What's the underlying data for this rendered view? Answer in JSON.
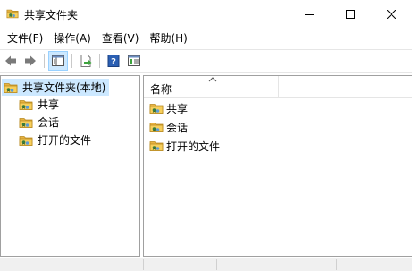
{
  "window": {
    "title": "共享文件夹",
    "icon": "shared-folder-icon"
  },
  "menubar": {
    "items": [
      {
        "label": "文件(F)"
      },
      {
        "label": "操作(A)"
      },
      {
        "label": "查看(V)"
      },
      {
        "label": "帮助(H)"
      }
    ]
  },
  "toolbar": {
    "buttons": [
      "back-arrow-icon",
      "forward-arrow-icon",
      "show-hide-tree-icon",
      "export-list-icon",
      "help-icon",
      "properties-pane-icon"
    ]
  },
  "tree": {
    "root": {
      "label": "共享文件夹(本地)",
      "selected": true
    },
    "children": [
      {
        "label": "共享"
      },
      {
        "label": "会话"
      },
      {
        "label": "打开的文件"
      }
    ]
  },
  "list": {
    "column_header": "名称",
    "sort_direction": "ascending",
    "items": [
      {
        "label": "共享"
      },
      {
        "label": "会话"
      },
      {
        "label": "打开的文件"
      }
    ]
  },
  "colors": {
    "selection_bg": "#cce8ff",
    "selection_border": "#99d1ff",
    "pane_border": "#a0a0a0",
    "folder_yellow": "#f5c342",
    "status_bg": "#f0f0f0"
  }
}
